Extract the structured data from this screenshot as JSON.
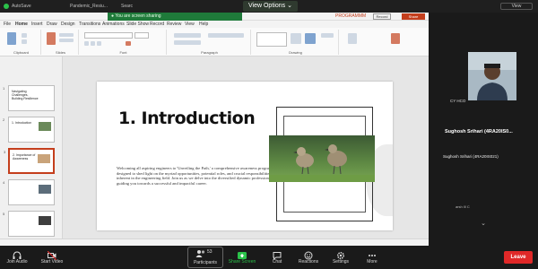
{
  "zoom": {
    "autosave_label": "AutoSave",
    "file_name": "Pandemic_Resiu...",
    "search_label": "Searc",
    "view_options_label": "View Options",
    "top_right_label": "View"
  },
  "ppt": {
    "user_name": "PROGRAMMM",
    "record_label": "Record",
    "share_label": "Share",
    "menu": [
      "File",
      "Home",
      "Insert",
      "Draw",
      "Design",
      "Transitions",
      "Animations",
      "Slide Show",
      "Record",
      "Review",
      "View",
      "Help"
    ],
    "ribbon_groups": [
      "Clipboard",
      "Slides",
      "Font",
      "Paragraph",
      "Drawing"
    ],
    "thumbnails": [
      {
        "num": "1",
        "title": "Navigating Challenges, Building Resilience"
      },
      {
        "num": "2",
        "title": "1. Introduction"
      },
      {
        "num": "3",
        "title": "2. Importance of Awareness"
      },
      {
        "num": "4",
        "title": ""
      },
      {
        "num": "5",
        "title": ""
      },
      {
        "num": "6",
        "title": ""
      },
      {
        "num": "7",
        "title": ""
      }
    ],
    "slide": {
      "title": "1. Introduction",
      "body": "Welcoming all aspiring engineers to 'Unveiling the Path,' a comprehensive awareness program designed to shed light on the myriad opportunities, potential roles, and crucial responsibilities inherent in the engineering field. Join us as we delve into the diversified dynamic profession, guiding you towards a successful and impactful career."
    }
  },
  "participants": {
    "self_label": "CY HCO",
    "speaker_name": "Sughosh Srihari (4RA20IS0...",
    "speaker_full": "Sughosh Srihari (4RA20IS021)",
    "self_paused": "arsh Ill C"
  },
  "toolbar": {
    "join_audio": "Join Audio",
    "start_video": "Start Video",
    "participants": "Participants",
    "participants_count": "53",
    "share_screen": "Share Screen",
    "chat": "Chat",
    "reactions": "Reactions",
    "settings": "Settings",
    "more": "More",
    "leave": "Leave"
  }
}
